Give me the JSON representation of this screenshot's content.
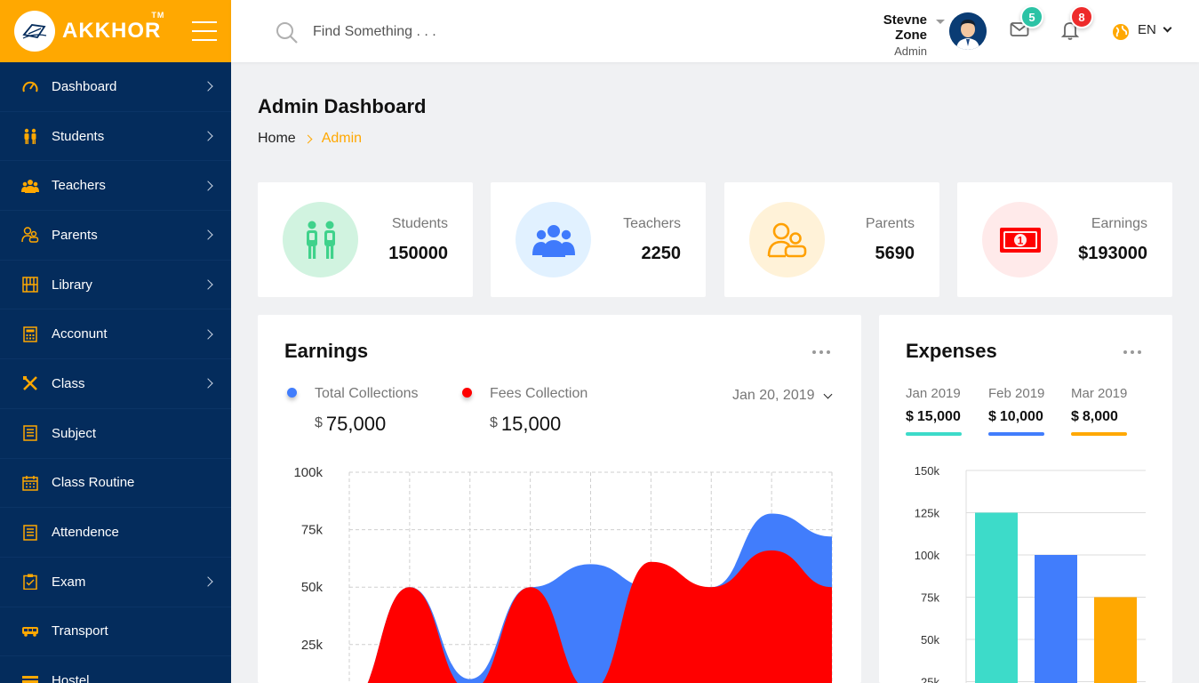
{
  "brand": {
    "name": "AKKHOR",
    "tm": "TM"
  },
  "colors": {
    "brand": "#ffa801",
    "sidebar": "#042c5c",
    "green": "#3ddbc9",
    "blue": "#417dfc",
    "orange": "#ffa801",
    "red": "#ff0000"
  },
  "sidebar": {
    "items": [
      {
        "label": "Dashboard",
        "icon": "speedometer-icon",
        "arrow": true
      },
      {
        "label": "Students",
        "icon": "students-icon",
        "arrow": true
      },
      {
        "label": "Teachers",
        "icon": "teachers-icon",
        "arrow": true
      },
      {
        "label": "Parents",
        "icon": "parents-icon",
        "arrow": true
      },
      {
        "label": "Library",
        "icon": "library-icon",
        "arrow": true
      },
      {
        "label": "Acconunt",
        "icon": "calculator-icon",
        "arrow": true
      },
      {
        "label": "Class",
        "icon": "class-icon",
        "arrow": true
      },
      {
        "label": "Subject",
        "icon": "book-icon",
        "arrow": false
      },
      {
        "label": "Class Routine",
        "icon": "calendar-icon",
        "arrow": false
      },
      {
        "label": "Attendence",
        "icon": "checklist-icon",
        "arrow": false
      },
      {
        "label": "Exam",
        "icon": "clipboard-icon",
        "arrow": true
      },
      {
        "label": "Transport",
        "icon": "bus-icon",
        "arrow": false
      },
      {
        "label": "Hostel",
        "icon": "bed-icon",
        "arrow": false
      }
    ]
  },
  "header": {
    "search_placeholder": "Find Something . . .",
    "user_name": "Stevne Zone",
    "user_role": "Admin",
    "mail_count": "5",
    "notification_count": "8",
    "language": "EN"
  },
  "page": {
    "title": "Admin Dashboard",
    "breadcrumb_home": "Home",
    "breadcrumb_current": "Admin"
  },
  "stats": [
    {
      "label": "Students",
      "value": "150000",
      "icon": "students-icon",
      "bg": "#d1f3e0",
      "color": "#3fd28b"
    },
    {
      "label": "Teachers",
      "value": "2250",
      "icon": "teachers-icon",
      "bg": "#e1f1ff",
      "color": "#3f7afc"
    },
    {
      "label": "Parents",
      "value": "5690",
      "icon": "parents-icon",
      "bg": "#fff2d8",
      "color": "#ffa001"
    },
    {
      "label": "Earnings",
      "value": "$193000",
      "icon": "money-icon",
      "bg": "#ffeaea",
      "color": "#ff0000"
    }
  ],
  "earnings": {
    "title": "Earnings",
    "total_label": "Total Collections",
    "total_currency": "$",
    "total_value": "75,000",
    "fees_label": "Fees Collection",
    "fees_currency": "$",
    "fees_value": "15,000",
    "date": "Jan 20, 2019"
  },
  "expenses": {
    "title": "Expenses",
    "items": [
      {
        "month": "Jan 2019",
        "currency": "$",
        "amount": "15,000",
        "color": "#3ddbc9"
      },
      {
        "month": "Feb 2019",
        "currency": "$",
        "amount": "10,000",
        "color": "#417dfc"
      },
      {
        "month": "Mar 2019",
        "currency": "$",
        "amount": "8,000",
        "color": "#ffa801"
      }
    ]
  },
  "chart_data": [
    {
      "type": "area",
      "title": "",
      "x": [
        0,
        1,
        2,
        3,
        4,
        5,
        6,
        7,
        8
      ],
      "ylim": [
        0,
        100000
      ],
      "y_ticks": [
        "100k",
        "75k",
        "50k",
        "25k"
      ],
      "y_tick_values": [
        100000,
        75000,
        50000,
        25000
      ],
      "grid": true,
      "series": [
        {
          "name": "Total Collections",
          "color": "#417dfc",
          "values": [
            0,
            50000,
            10000,
            50000,
            60000,
            50000,
            50000,
            82000,
            72000
          ]
        },
        {
          "name": "Fees Collection",
          "color": "#ff0000",
          "values": [
            0,
            50000,
            5000,
            50000,
            5000,
            61000,
            50000,
            66000,
            50000
          ]
        }
      ]
    },
    {
      "type": "bar",
      "title": "",
      "categories": [
        "Jan 2019",
        "Feb 2019",
        "Mar 2019"
      ],
      "values": [
        125000,
        100000,
        75000
      ],
      "colors": [
        "#3ddbc9",
        "#417dfc",
        "#ffa801"
      ],
      "ylim": [
        0,
        150000
      ],
      "y_ticks": [
        "150k",
        "125k",
        "100k",
        "75k",
        "50k",
        "25k"
      ],
      "y_tick_values": [
        150000,
        125000,
        100000,
        75000,
        50000,
        25000
      ],
      "grid": true
    }
  ]
}
